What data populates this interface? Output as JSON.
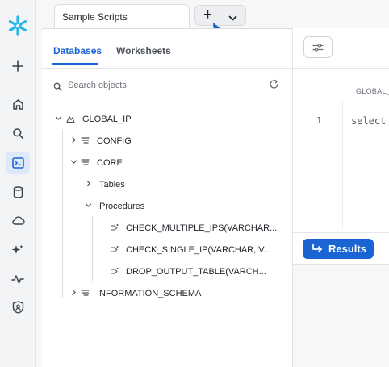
{
  "app": {
    "brand_icon": "snowflake-logo",
    "accent": "#1b64d4",
    "annotation_color": "#1a5fd6"
  },
  "rail": {
    "items": [
      {
        "icon": "plus-icon",
        "active": false
      },
      {
        "icon": "home-icon",
        "active": false
      },
      {
        "icon": "search-icon",
        "active": false
      },
      {
        "icon": "worksheets-icon",
        "active": true
      },
      {
        "icon": "data-icon",
        "active": false
      },
      {
        "icon": "cloud-icon",
        "active": false
      },
      {
        "icon": "ai-sparkle-icon",
        "active": false
      },
      {
        "icon": "monitoring-icon",
        "active": false
      },
      {
        "icon": "admin-shield-icon",
        "active": false
      }
    ]
  },
  "tabs": {
    "file_tab": "Sample Scripts",
    "add_label": "+"
  },
  "explorer": {
    "tabs": [
      "Databases",
      "Worksheets"
    ],
    "active_tab": "Databases",
    "search_placeholder": "Search objects",
    "tree": {
      "database": "GLOBAL_IP",
      "schemas": [
        "CONFIG",
        "CORE",
        "INFORMATION_SCHEMA"
      ],
      "core_children": [
        "Tables",
        "Procedures"
      ],
      "procedures": [
        "CHECK_MULTIPLE_IPS(VARCHAR...",
        "CHECK_SINGLE_IP(VARCHAR, V...",
        "DROP_OUTPUT_TABLE(VARCH..."
      ]
    }
  },
  "editor": {
    "column_header": "GLOBAL_",
    "line_number": "1",
    "code_line": "select",
    "results_label": "Results"
  }
}
